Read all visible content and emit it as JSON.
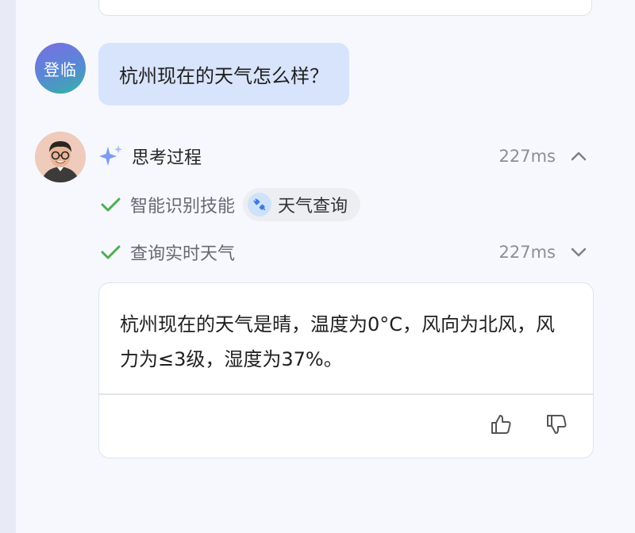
{
  "user_message": {
    "avatar_text": "登临",
    "text": "杭州现在的天气怎么样？"
  },
  "thinking": {
    "title": "思考过程",
    "time": "227ms",
    "expanded": true
  },
  "steps": [
    {
      "label": "智能识别技能",
      "skill": "天气查询",
      "status": "done"
    },
    {
      "label": "查询实时天气",
      "time": "227ms",
      "status": "done",
      "expanded": false
    }
  ],
  "answer": {
    "text": "杭州现在的天气是晴，温度为0°C，风向为北风，风力为≤3级，湿度为37%。"
  },
  "colors": {
    "check": "#4caf50",
    "user_bubble": "#d8e4fb",
    "sparkle": "#6f8ff0"
  }
}
